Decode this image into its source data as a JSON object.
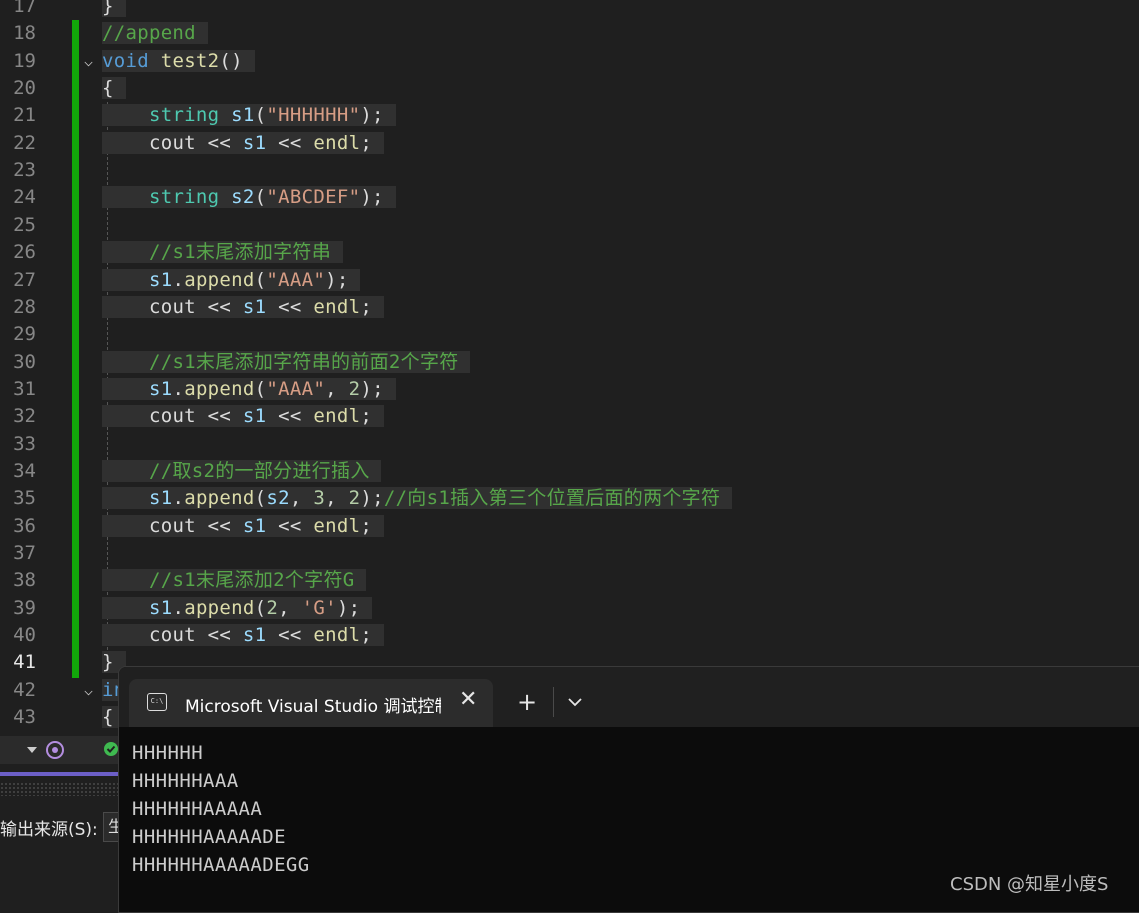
{
  "editor": {
    "lines": [
      {
        "num": "17",
        "tokens": [
          {
            "t": "}",
            "c": "pl"
          }
        ]
      },
      {
        "num": "18",
        "tokens": [
          {
            "t": "//append",
            "c": "cm"
          }
        ]
      },
      {
        "num": "19",
        "tokens": [
          {
            "t": "void",
            "c": "kw"
          },
          {
            "t": " ",
            "c": "pl"
          },
          {
            "t": "test2",
            "c": "fn"
          },
          {
            "t": "()",
            "c": "pl"
          }
        ],
        "fold": true
      },
      {
        "num": "20",
        "tokens": [
          {
            "t": "{",
            "c": "pl"
          }
        ]
      },
      {
        "num": "21",
        "tokens": [
          {
            "t": "    ",
            "c": "pl"
          },
          {
            "t": "string",
            "c": "ty"
          },
          {
            "t": " ",
            "c": "pl"
          },
          {
            "t": "s1",
            "c": "vr"
          },
          {
            "t": "(",
            "c": "pl"
          },
          {
            "t": "\"HHHHHH\"",
            "c": "st"
          },
          {
            "t": ");",
            "c": "pl"
          }
        ]
      },
      {
        "num": "22",
        "tokens": [
          {
            "t": "    ",
            "c": "pl"
          },
          {
            "t": "cout",
            "c": "pl"
          },
          {
            "t": " << ",
            "c": "pl"
          },
          {
            "t": "s1",
            "c": "vr"
          },
          {
            "t": " << ",
            "c": "pl"
          },
          {
            "t": "endl",
            "c": "fn"
          },
          {
            "t": ";",
            "c": "pl"
          }
        ]
      },
      {
        "num": "23",
        "tokens": []
      },
      {
        "num": "24",
        "tokens": [
          {
            "t": "    ",
            "c": "pl"
          },
          {
            "t": "string",
            "c": "ty"
          },
          {
            "t": " ",
            "c": "pl"
          },
          {
            "t": "s2",
            "c": "vr"
          },
          {
            "t": "(",
            "c": "pl"
          },
          {
            "t": "\"ABCDEF\"",
            "c": "st"
          },
          {
            "t": ");",
            "c": "pl"
          }
        ]
      },
      {
        "num": "25",
        "tokens": []
      },
      {
        "num": "26",
        "tokens": [
          {
            "t": "    ",
            "c": "pl"
          },
          {
            "t": "//s1末尾添加字符串",
            "c": "cm"
          }
        ]
      },
      {
        "num": "27",
        "tokens": [
          {
            "t": "    ",
            "c": "pl"
          },
          {
            "t": "s1",
            "c": "vr"
          },
          {
            "t": ".",
            "c": "pl"
          },
          {
            "t": "append",
            "c": "fn"
          },
          {
            "t": "(",
            "c": "pl"
          },
          {
            "t": "\"AAA\"",
            "c": "st"
          },
          {
            "t": ");",
            "c": "pl"
          }
        ]
      },
      {
        "num": "28",
        "tokens": [
          {
            "t": "    ",
            "c": "pl"
          },
          {
            "t": "cout",
            "c": "pl"
          },
          {
            "t": " << ",
            "c": "pl"
          },
          {
            "t": "s1",
            "c": "vr"
          },
          {
            "t": " << ",
            "c": "pl"
          },
          {
            "t": "endl",
            "c": "fn"
          },
          {
            "t": ";",
            "c": "pl"
          }
        ]
      },
      {
        "num": "29",
        "tokens": []
      },
      {
        "num": "30",
        "tokens": [
          {
            "t": "    ",
            "c": "pl"
          },
          {
            "t": "//s1末尾添加字符串的前面2个字符",
            "c": "cm"
          }
        ]
      },
      {
        "num": "31",
        "tokens": [
          {
            "t": "    ",
            "c": "pl"
          },
          {
            "t": "s1",
            "c": "vr"
          },
          {
            "t": ".",
            "c": "pl"
          },
          {
            "t": "append",
            "c": "fn"
          },
          {
            "t": "(",
            "c": "pl"
          },
          {
            "t": "\"AAA\"",
            "c": "st"
          },
          {
            "t": ", ",
            "c": "pl"
          },
          {
            "t": "2",
            "c": "nm"
          },
          {
            "t": ");",
            "c": "pl"
          }
        ]
      },
      {
        "num": "32",
        "tokens": [
          {
            "t": "    ",
            "c": "pl"
          },
          {
            "t": "cout",
            "c": "pl"
          },
          {
            "t": " << ",
            "c": "pl"
          },
          {
            "t": "s1",
            "c": "vr"
          },
          {
            "t": " << ",
            "c": "pl"
          },
          {
            "t": "endl",
            "c": "fn"
          },
          {
            "t": ";",
            "c": "pl"
          }
        ]
      },
      {
        "num": "33",
        "tokens": []
      },
      {
        "num": "34",
        "tokens": [
          {
            "t": "    ",
            "c": "pl"
          },
          {
            "t": "//取s2的一部分进行插入",
            "c": "cm"
          }
        ]
      },
      {
        "num": "35",
        "tokens": [
          {
            "t": "    ",
            "c": "pl"
          },
          {
            "t": "s1",
            "c": "vr"
          },
          {
            "t": ".",
            "c": "pl"
          },
          {
            "t": "append",
            "c": "fn"
          },
          {
            "t": "(",
            "c": "pl"
          },
          {
            "t": "s2",
            "c": "vr"
          },
          {
            "t": ", ",
            "c": "pl"
          },
          {
            "t": "3",
            "c": "nm"
          },
          {
            "t": ", ",
            "c": "pl"
          },
          {
            "t": "2",
            "c": "nm"
          },
          {
            "t": ");",
            "c": "pl"
          },
          {
            "t": "//向s1插入第三个位置后面的两个字符",
            "c": "cm"
          }
        ]
      },
      {
        "num": "36",
        "tokens": [
          {
            "t": "    ",
            "c": "pl"
          },
          {
            "t": "cout",
            "c": "pl"
          },
          {
            "t": " << ",
            "c": "pl"
          },
          {
            "t": "s1",
            "c": "vr"
          },
          {
            "t": " << ",
            "c": "pl"
          },
          {
            "t": "endl",
            "c": "fn"
          },
          {
            "t": ";",
            "c": "pl"
          }
        ]
      },
      {
        "num": "37",
        "tokens": []
      },
      {
        "num": "38",
        "tokens": [
          {
            "t": "    ",
            "c": "pl"
          },
          {
            "t": "//s1末尾添加2个字符G",
            "c": "cm"
          }
        ]
      },
      {
        "num": "39",
        "tokens": [
          {
            "t": "    ",
            "c": "pl"
          },
          {
            "t": "s1",
            "c": "vr"
          },
          {
            "t": ".",
            "c": "pl"
          },
          {
            "t": "append",
            "c": "fn"
          },
          {
            "t": "(",
            "c": "pl"
          },
          {
            "t": "2",
            "c": "nm"
          },
          {
            "t": ", ",
            "c": "pl"
          },
          {
            "t": "'G'",
            "c": "st"
          },
          {
            "t": ");",
            "c": "pl"
          }
        ]
      },
      {
        "num": "40",
        "tokens": [
          {
            "t": "    ",
            "c": "pl"
          },
          {
            "t": "cout",
            "c": "pl"
          },
          {
            "t": " << ",
            "c": "pl"
          },
          {
            "t": "s1",
            "c": "vr"
          },
          {
            "t": " << ",
            "c": "pl"
          },
          {
            "t": "endl",
            "c": "fn"
          },
          {
            "t": ";",
            "c": "pl"
          }
        ]
      },
      {
        "num": "41",
        "tokens": [
          {
            "t": "}",
            "c": "pl"
          }
        ],
        "active": true
      },
      {
        "num": "42",
        "tokens": [
          {
            "t": "in",
            "c": "kw"
          }
        ],
        "fold": true
      },
      {
        "num": "43",
        "tokens": [
          {
            "t": "{",
            "c": "pl"
          }
        ]
      }
    ]
  },
  "output_panel": {
    "source_label": "输出来源(S):",
    "source_value": "生"
  },
  "console": {
    "tab_title": "Microsoft Visual Studio 调试控制台",
    "tab_icon_text": "C:\\",
    "close_glyph": "✕",
    "new_tab_glyph": "+",
    "output": [
      "HHHHHH",
      "HHHHHHAAA",
      "HHHHHHAAAAA",
      "HHHHHHAAAAADE",
      "HHHHHHAAAAADEGG"
    ]
  },
  "watermark": "CSDN @知星小度S",
  "colors": {
    "editor_bg": "#1f1f1f",
    "comment": "#57a64a",
    "keyword": "#569cd6",
    "string": "#d69d85",
    "change_bar": "#12a70a",
    "console_bg": "#0c0c0c"
  }
}
